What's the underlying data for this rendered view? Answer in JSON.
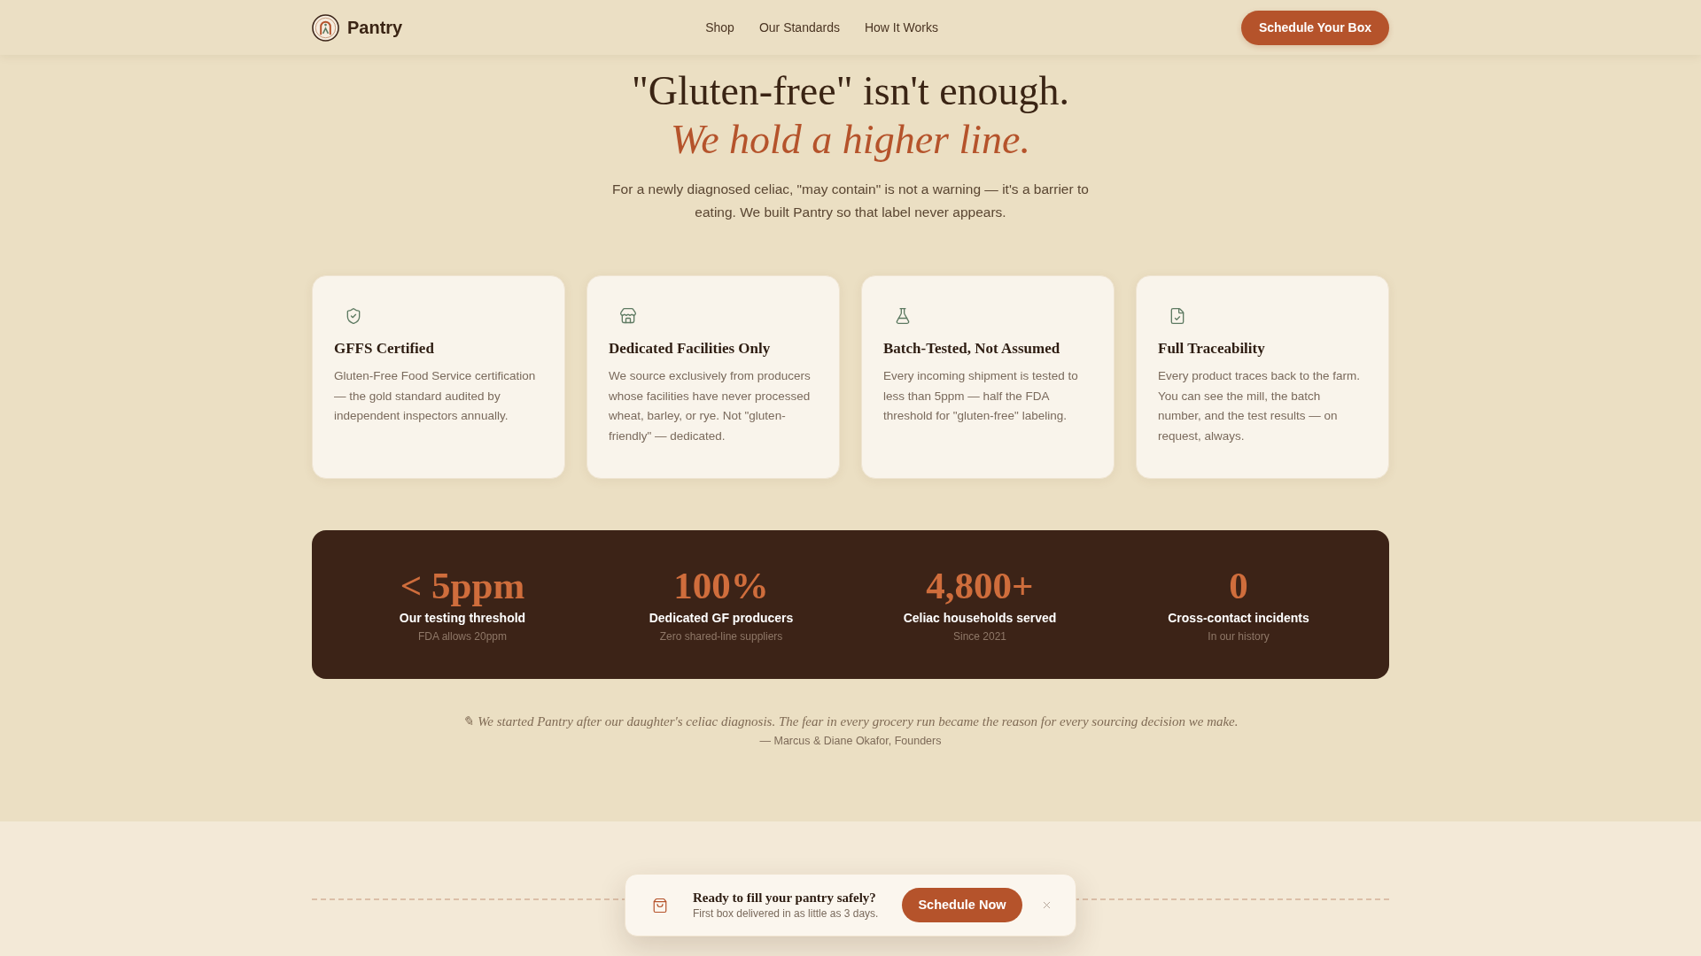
{
  "nav": {
    "brand": "Pantry",
    "links": [
      {
        "label": "Shop"
      },
      {
        "label": "Our Standards"
      },
      {
        "label": "How It Works"
      }
    ],
    "cta": "Schedule Your Box"
  },
  "hero": {
    "title": "\"Gluten-free\" isn't enough.",
    "accent": "We hold a higher line.",
    "lede": "For a newly diagnosed celiac, \"may contain\" is not a warning — it's a barrier to eating. We built Pantry so that label never appears."
  },
  "features": [
    {
      "title": "GFFS Certified",
      "text": "Gluten-Free Food Service certification — the gold standard audited by independent inspectors annually."
    },
    {
      "title": "Dedicated Facilities Only",
      "text": "We source exclusively from producers whose facilities have never processed wheat, barley, or rye. Not \"gluten-friendly\" — dedicated."
    },
    {
      "title": "Batch-Tested, Not Assumed",
      "text": "Every incoming shipment is tested to less than 5ppm — half the FDA threshold for \"gluten-free\" labeling."
    },
    {
      "title": "Full Traceability",
      "text": "Every product traces back to the farm. You can see the mill, the batch number, and the test results — on request, always."
    }
  ],
  "stats": [
    {
      "value": "< 5ppm",
      "label": "Our testing threshold",
      "note": "FDA allows 20ppm"
    },
    {
      "value": "100%",
      "label": "Dedicated GF producers",
      "note": "Zero shared-line suppliers"
    },
    {
      "value": "4,800+",
      "label": "Celiac households served",
      "note": "Since 2021"
    },
    {
      "value": "0",
      "label": "Cross-contact incidents",
      "note": "In our history"
    }
  ],
  "quote": {
    "text": "✎ We started Pantry after our daughter's celiac diagnosis. The fear in every grocery run became the reason for every sourcing decision we make.",
    "attribution": "— Marcus & Diane Okafor, Founders"
  },
  "toast": {
    "title": "Ready to fill your pantry safely?",
    "text": "First box delivered in as little as 3 days.",
    "button": "Schedule Now"
  }
}
